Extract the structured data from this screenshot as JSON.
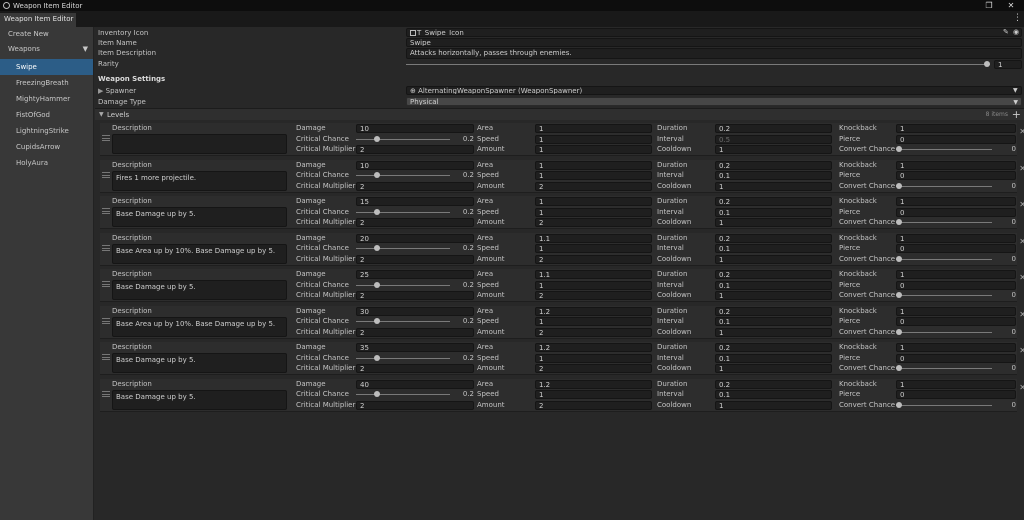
{
  "window": {
    "title": "Weapon Item Editor",
    "tab": "Weapon Item Editor"
  },
  "sidebar": {
    "create_new": "Create New",
    "group": "Weapons",
    "items": [
      "Swipe",
      "FreezingBreath",
      "MightyHammer",
      "FistOfGod",
      "LightningStrike",
      "CupidsArrow",
      "HolyAura"
    ],
    "selected_index": 0
  },
  "props": {
    "inventory_icon_label": "Inventory Icon",
    "inventory_icon_value": "T_Swipe_Icon",
    "item_name_label": "Item Name",
    "item_name_value": "Swipe",
    "item_description_label": "Item Description",
    "item_description_value": "Attacks horizontally, passes through enemies.",
    "rarity_label": "Rarity",
    "rarity_value": "1",
    "rarity_fraction": 1.0
  },
  "weapon_settings": {
    "header": "Weapon Settings",
    "spawner_label": "Spawner",
    "spawner_value": "AlternatingWeaponSpawner (WeaponSpawner)",
    "damage_type_label": "Damage Type",
    "damage_type_value": "Physical"
  },
  "levels_section": {
    "label": "Levels",
    "count_text": "8 items"
  },
  "field_labels": {
    "description": "Description",
    "damage": "Damage",
    "critical_chance": "Critical Chance",
    "critical_multiplier": "Critical Multiplier",
    "area": "Area",
    "speed": "Speed",
    "amount": "Amount",
    "duration": "Duration",
    "interval": "Interval",
    "cooldown": "Cooldown",
    "knockback": "Knockback",
    "pierce": "Pierce",
    "convert_chance": "Convert Chance"
  },
  "levels": [
    {
      "description": "",
      "damage": "10",
      "crit_chance": "0.2",
      "crit_mult": "2",
      "area": "1",
      "speed": "1",
      "amount": "1",
      "duration": "0.2",
      "interval": "0.5",
      "interval_disabled": true,
      "cooldown": "1",
      "knockback": "1",
      "pierce": "0",
      "convert": "0"
    },
    {
      "description": "Fires 1 more projectile.",
      "damage": "10",
      "crit_chance": "0.2",
      "crit_mult": "2",
      "area": "1",
      "speed": "1",
      "amount": "2",
      "duration": "0.2",
      "interval": "0.1",
      "interval_disabled": false,
      "cooldown": "1",
      "knockback": "1",
      "pierce": "0",
      "convert": "0"
    },
    {
      "description": "Base Damage up by 5.",
      "damage": "15",
      "crit_chance": "0.2",
      "crit_mult": "2",
      "area": "1",
      "speed": "1",
      "amount": "2",
      "duration": "0.2",
      "interval": "0.1",
      "interval_disabled": false,
      "cooldown": "1",
      "knockback": "1",
      "pierce": "0",
      "convert": "0"
    },
    {
      "description": "Base Area up by 10%. Base Damage up by 5.",
      "damage": "20",
      "crit_chance": "0.2",
      "crit_mult": "2",
      "area": "1.1",
      "speed": "1",
      "amount": "2",
      "duration": "0.2",
      "interval": "0.1",
      "interval_disabled": false,
      "cooldown": "1",
      "knockback": "1",
      "pierce": "0",
      "convert": "0"
    },
    {
      "description": "Base Damage up by 5.",
      "damage": "25",
      "crit_chance": "0.2",
      "crit_mult": "2",
      "area": "1.1",
      "speed": "1",
      "amount": "2",
      "duration": "0.2",
      "interval": "0.1",
      "interval_disabled": false,
      "cooldown": "1",
      "knockback": "1",
      "pierce": "0",
      "convert": "0"
    },
    {
      "description": "Base Area up by 10%. Base Damage up by 5.",
      "damage": "30",
      "crit_chance": "0.2",
      "crit_mult": "2",
      "area": "1.2",
      "speed": "1",
      "amount": "2",
      "duration": "0.2",
      "interval": "0.1",
      "interval_disabled": false,
      "cooldown": "1",
      "knockback": "1",
      "pierce": "0",
      "convert": "0"
    },
    {
      "description": "Base Damage up by 5.",
      "damage": "35",
      "crit_chance": "0.2",
      "crit_mult": "2",
      "area": "1.2",
      "speed": "1",
      "amount": "2",
      "duration": "0.2",
      "interval": "0.1",
      "interval_disabled": false,
      "cooldown": "1",
      "knockback": "1",
      "pierce": "0",
      "convert": "0"
    },
    {
      "description": "Base Damage up by 5.",
      "damage": "40",
      "crit_chance": "0.2",
      "crit_mult": "2",
      "area": "1.2",
      "speed": "1",
      "amount": "2",
      "duration": "0.2",
      "interval": "0.1",
      "interval_disabled": false,
      "cooldown": "1",
      "knockback": "1",
      "pierce": "0",
      "convert": "0"
    }
  ],
  "colors": {
    "accent": "#2c5d87",
    "background": "#282828",
    "panel": "#383838",
    "field": "#1f1f1f"
  }
}
